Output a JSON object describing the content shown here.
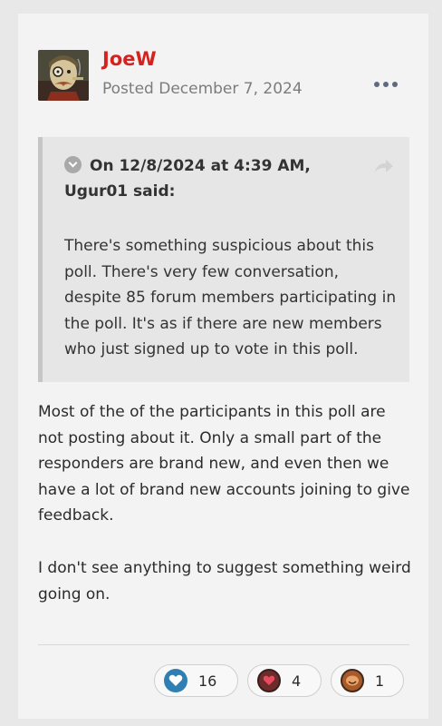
{
  "post": {
    "author": "JoeW",
    "posted": "Posted December 7, 2024"
  },
  "quote": {
    "header": "On 12/8/2024 at 4:39 AM, Ugur01 said:",
    "body": "There's something suspicious about this poll. There's very few conversation, despite 85 forum members participating in the poll. It's as if there are new members who just signed up to vote in this poll."
  },
  "content": {
    "paragraph1": "Most of the of the participants in this poll are not posting about it. Only a small part of the responders are brand new, and even then we have a lot of brand new accounts joining to give feedback.",
    "paragraph2": "I don't see anything to suggest something weird going on."
  },
  "reactions": [
    {
      "icon": "like-heart-icon",
      "count": "16"
    },
    {
      "icon": "love-heart-icon",
      "count": "4"
    },
    {
      "icon": "haha-face-icon",
      "count": "1"
    }
  ],
  "colors": {
    "author": "#d6221f",
    "like": "#2f7fb3"
  }
}
